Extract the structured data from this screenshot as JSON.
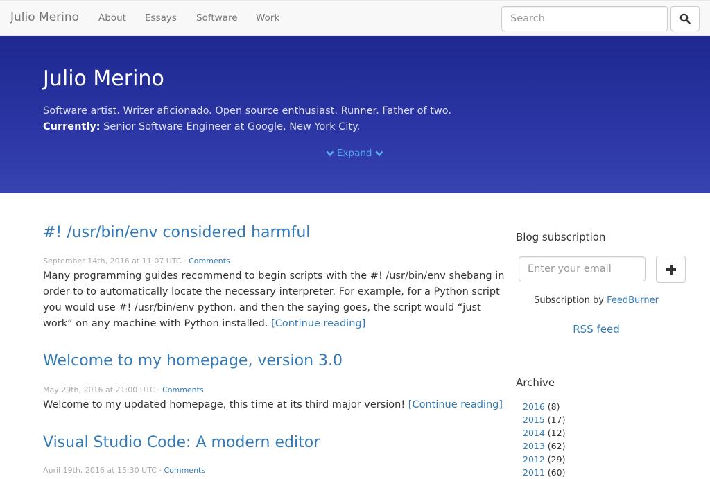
{
  "navbar": {
    "brand": "Julio Merino",
    "links": [
      "About",
      "Essays",
      "Software",
      "Work"
    ],
    "search_placeholder": "Search",
    "search_icon": "search-icon"
  },
  "hero": {
    "title": "Julio Merino",
    "tagline": "Software artist. Writer aficionado. Open source enthusiast. Runner. Father of two.",
    "currently_label": "Currently:",
    "currently_text": "Senior Software Engineer at Google, New York City.",
    "expand_label": "Expand",
    "expand_icon": "chevron-down-icon"
  },
  "posts": [
    {
      "title": "#! /usr/bin/env considered harmful",
      "date": "September 14th, 2016 at 11:07 UTC",
      "comments": "Comments",
      "excerpt": "Many programming guides recommend to begin scripts with the #! /usr/bin/env shebang in order to to automatically locate the necessary interpreter. For example, for a Python script you would use #! /usr/bin/env python, and then the saying goes, the script would “just work” on any machine with Python installed.",
      "continue": "[Continue reading]"
    },
    {
      "title": "Welcome to my homepage, version 3.0",
      "date": "May 29th, 2016 at 21:00 UTC",
      "comments": "Comments",
      "excerpt": "Welcome to my updated homepage, this time at its third major version!",
      "continue": "[Continue reading]"
    },
    {
      "title": "Visual Studio Code: A modern editor",
      "date": "April 19th, 2016 at 15:30 UTC",
      "comments": "Comments"
    }
  ],
  "sidebar": {
    "subscription_heading": "Blog subscription",
    "email_placeholder": "Enter your email",
    "subscribe_icon": "plus-icon",
    "subscription_by": "Subscription by",
    "feedburner": "FeedBurner",
    "rss": "RSS feed",
    "archive_heading": "Archive",
    "archive": [
      {
        "year": "2016",
        "count": "(8)"
      },
      {
        "year": "2015",
        "count": "(17)"
      },
      {
        "year": "2014",
        "count": "(12)"
      },
      {
        "year": "2013",
        "count": "(62)"
      },
      {
        "year": "2012",
        "count": "(29)"
      },
      {
        "year": "2011",
        "count": "(60)"
      }
    ]
  },
  "colors": {
    "link": "#337ab7",
    "hero_gradient_top": "#1f2890",
    "hero_gradient_bottom": "#3843b2",
    "navbar_bg": "#f8f8f8"
  }
}
